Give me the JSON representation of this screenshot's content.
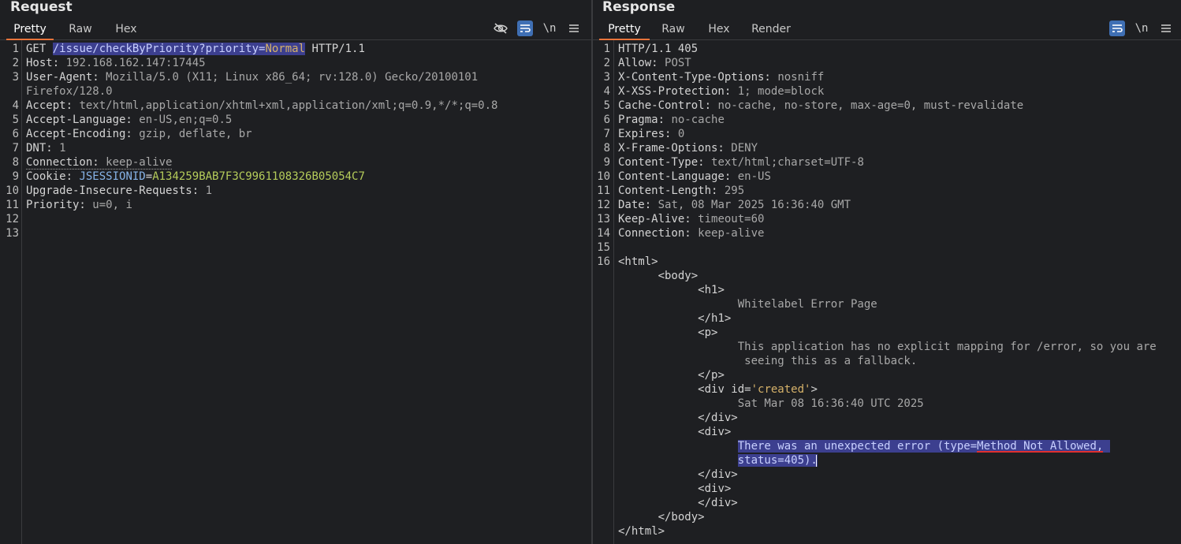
{
  "request": {
    "title": "Request",
    "tabs": [
      "Pretty",
      "Raw",
      "Hex"
    ],
    "active_tab": "Pretty",
    "tools": [
      "hide-icon",
      "wrap-icon",
      "\\n",
      "menu-icon"
    ],
    "line_numbers": [
      "1",
      "2",
      "3",
      "",
      "4",
      "5",
      "6",
      "7",
      "8",
      "9",
      "10",
      "11",
      "12",
      "13"
    ],
    "method": "GET",
    "path": "/issue/checkByPriority?priority=",
    "path_value": "Normal",
    "protocol": "HTTP/1.1",
    "headers": [
      {
        "k": "Host:",
        "v": "192.168.162.147:17445"
      },
      {
        "k": "User-Agent:",
        "v": "Mozilla/5.0 (X11; Linux x86_64; rv:128.0) Gecko/20100101"
      },
      {
        "k": "",
        "v": "Firefox/128.0"
      },
      {
        "k": "Accept:",
        "v": "text/html,application/xhtml+xml,application/xml;q=0.9,*/*;q=0.8"
      },
      {
        "k": "Accept-Language:",
        "v": "en-US,en;q=0.5"
      },
      {
        "k": "Accept-Encoding:",
        "v": "gzip, deflate, br"
      },
      {
        "k": "DNT:",
        "v": "1"
      },
      {
        "k": "Connection:",
        "v": "keep-alive"
      }
    ],
    "cookie_key": "Cookie:",
    "cookie_name": "JSESSIONID",
    "cookie_eq": "=",
    "cookie_value": "A134259BAB7F3C9961108326B05054C7",
    "headers2": [
      {
        "k": "Upgrade-Insecure-Requests:",
        "v": "1"
      },
      {
        "k": "Priority:",
        "v": "u=0, i"
      }
    ]
  },
  "response": {
    "title": "Response",
    "tabs": [
      "Pretty",
      "Raw",
      "Hex",
      "Render"
    ],
    "active_tab": "Pretty",
    "tools": [
      "wrap-icon",
      "\\n",
      "menu-icon"
    ],
    "line_numbers": [
      "1",
      "2",
      "3",
      "4",
      "5",
      "6",
      "7",
      "8",
      "9",
      "10",
      "11",
      "12",
      "13",
      "14",
      "15",
      "16"
    ],
    "status_line": "HTTP/1.1 405",
    "headers": [
      {
        "k": "Allow:",
        "v": "POST"
      },
      {
        "k": "X-Content-Type-Options:",
        "v": "nosniff"
      },
      {
        "k": "X-XSS-Protection:",
        "v": "1; mode=block"
      },
      {
        "k": "Cache-Control:",
        "v": "no-cache, no-store, max-age=0, must-revalidate"
      },
      {
        "k": "Pragma:",
        "v": "no-cache"
      },
      {
        "k": "Expires:",
        "v": "0"
      },
      {
        "k": "X-Frame-Options:",
        "v": "DENY"
      },
      {
        "k": "Content-Type:",
        "v": "text/html;charset=UTF-8"
      },
      {
        "k": "Content-Language:",
        "v": "en-US"
      },
      {
        "k": "Content-Length:",
        "v": "295"
      },
      {
        "k": "Date:",
        "v": "Sat, 08 Mar 2025 16:36:40 GMT"
      },
      {
        "k": "Keep-Alive:",
        "v": "timeout=60"
      },
      {
        "k": "Connection:",
        "v": "keep-alive"
      }
    ],
    "body": {
      "html_open": "<html>",
      "body_open": "<body>",
      "h1_open": "<h1>",
      "h1_text": "Whitelabel Error Page",
      "h1_close": "</h1>",
      "p_open": "<p>",
      "p_text_1": "This application has no explicit mapping for /error, so you are",
      "p_text_2": " seeing this as a fallback.",
      "p_close": "</p>",
      "div_created_open_a": "<div id=",
      "div_created_attr": "'created'",
      "div_created_open_b": ">",
      "created_text": "Sat Mar 08 16:36:40 UTC 2025",
      "div_close": "</div>",
      "div_open": "<div>",
      "err_text_a": "There was an unexpected error (type=",
      "err_text_b": "Method Not Allowed,",
      "err_text_c": "status=405).",
      "body_close": "</body>",
      "html_close": "</html>"
    }
  }
}
